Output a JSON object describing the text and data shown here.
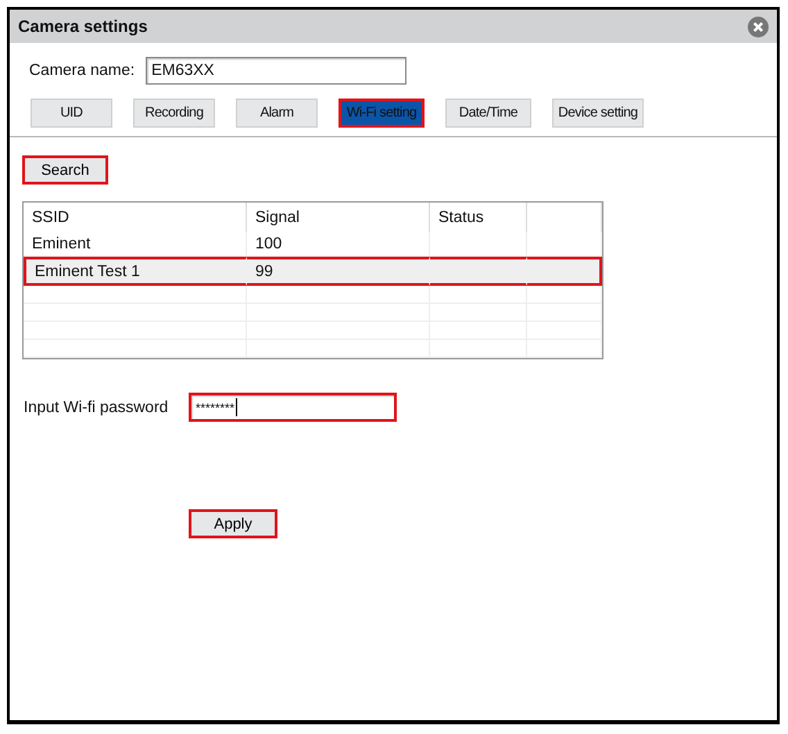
{
  "window": {
    "title": "Camera settings"
  },
  "camera_name": {
    "label": "Camera name:",
    "value": "EM63XX"
  },
  "tabs": [
    {
      "label": "UID",
      "selected": false,
      "highlighted": false
    },
    {
      "label": "Recording",
      "selected": false,
      "highlighted": false
    },
    {
      "label": "Alarm",
      "selected": false,
      "highlighted": false
    },
    {
      "label": "Wi-Fi setting",
      "selected": true,
      "highlighted": true
    },
    {
      "label": "Date/Time",
      "selected": false,
      "highlighted": false
    },
    {
      "label": "Device setting",
      "selected": false,
      "highlighted": false
    }
  ],
  "search_button": {
    "label": "Search",
    "highlighted": true
  },
  "table": {
    "columns": [
      "SSID",
      "Signal",
      "Status"
    ],
    "rows": [
      {
        "cells": [
          "Eminent",
          "100"
        ],
        "selected": false,
        "highlighted": false
      },
      {
        "cells": [
          "Eminent Test 1",
          "99"
        ],
        "selected": true,
        "highlighted": true
      }
    ]
  },
  "password": {
    "label": "Input Wi-fi password",
    "value": "********",
    "highlighted": true
  },
  "apply_button": {
    "label": "Apply",
    "highlighted": true
  }
}
